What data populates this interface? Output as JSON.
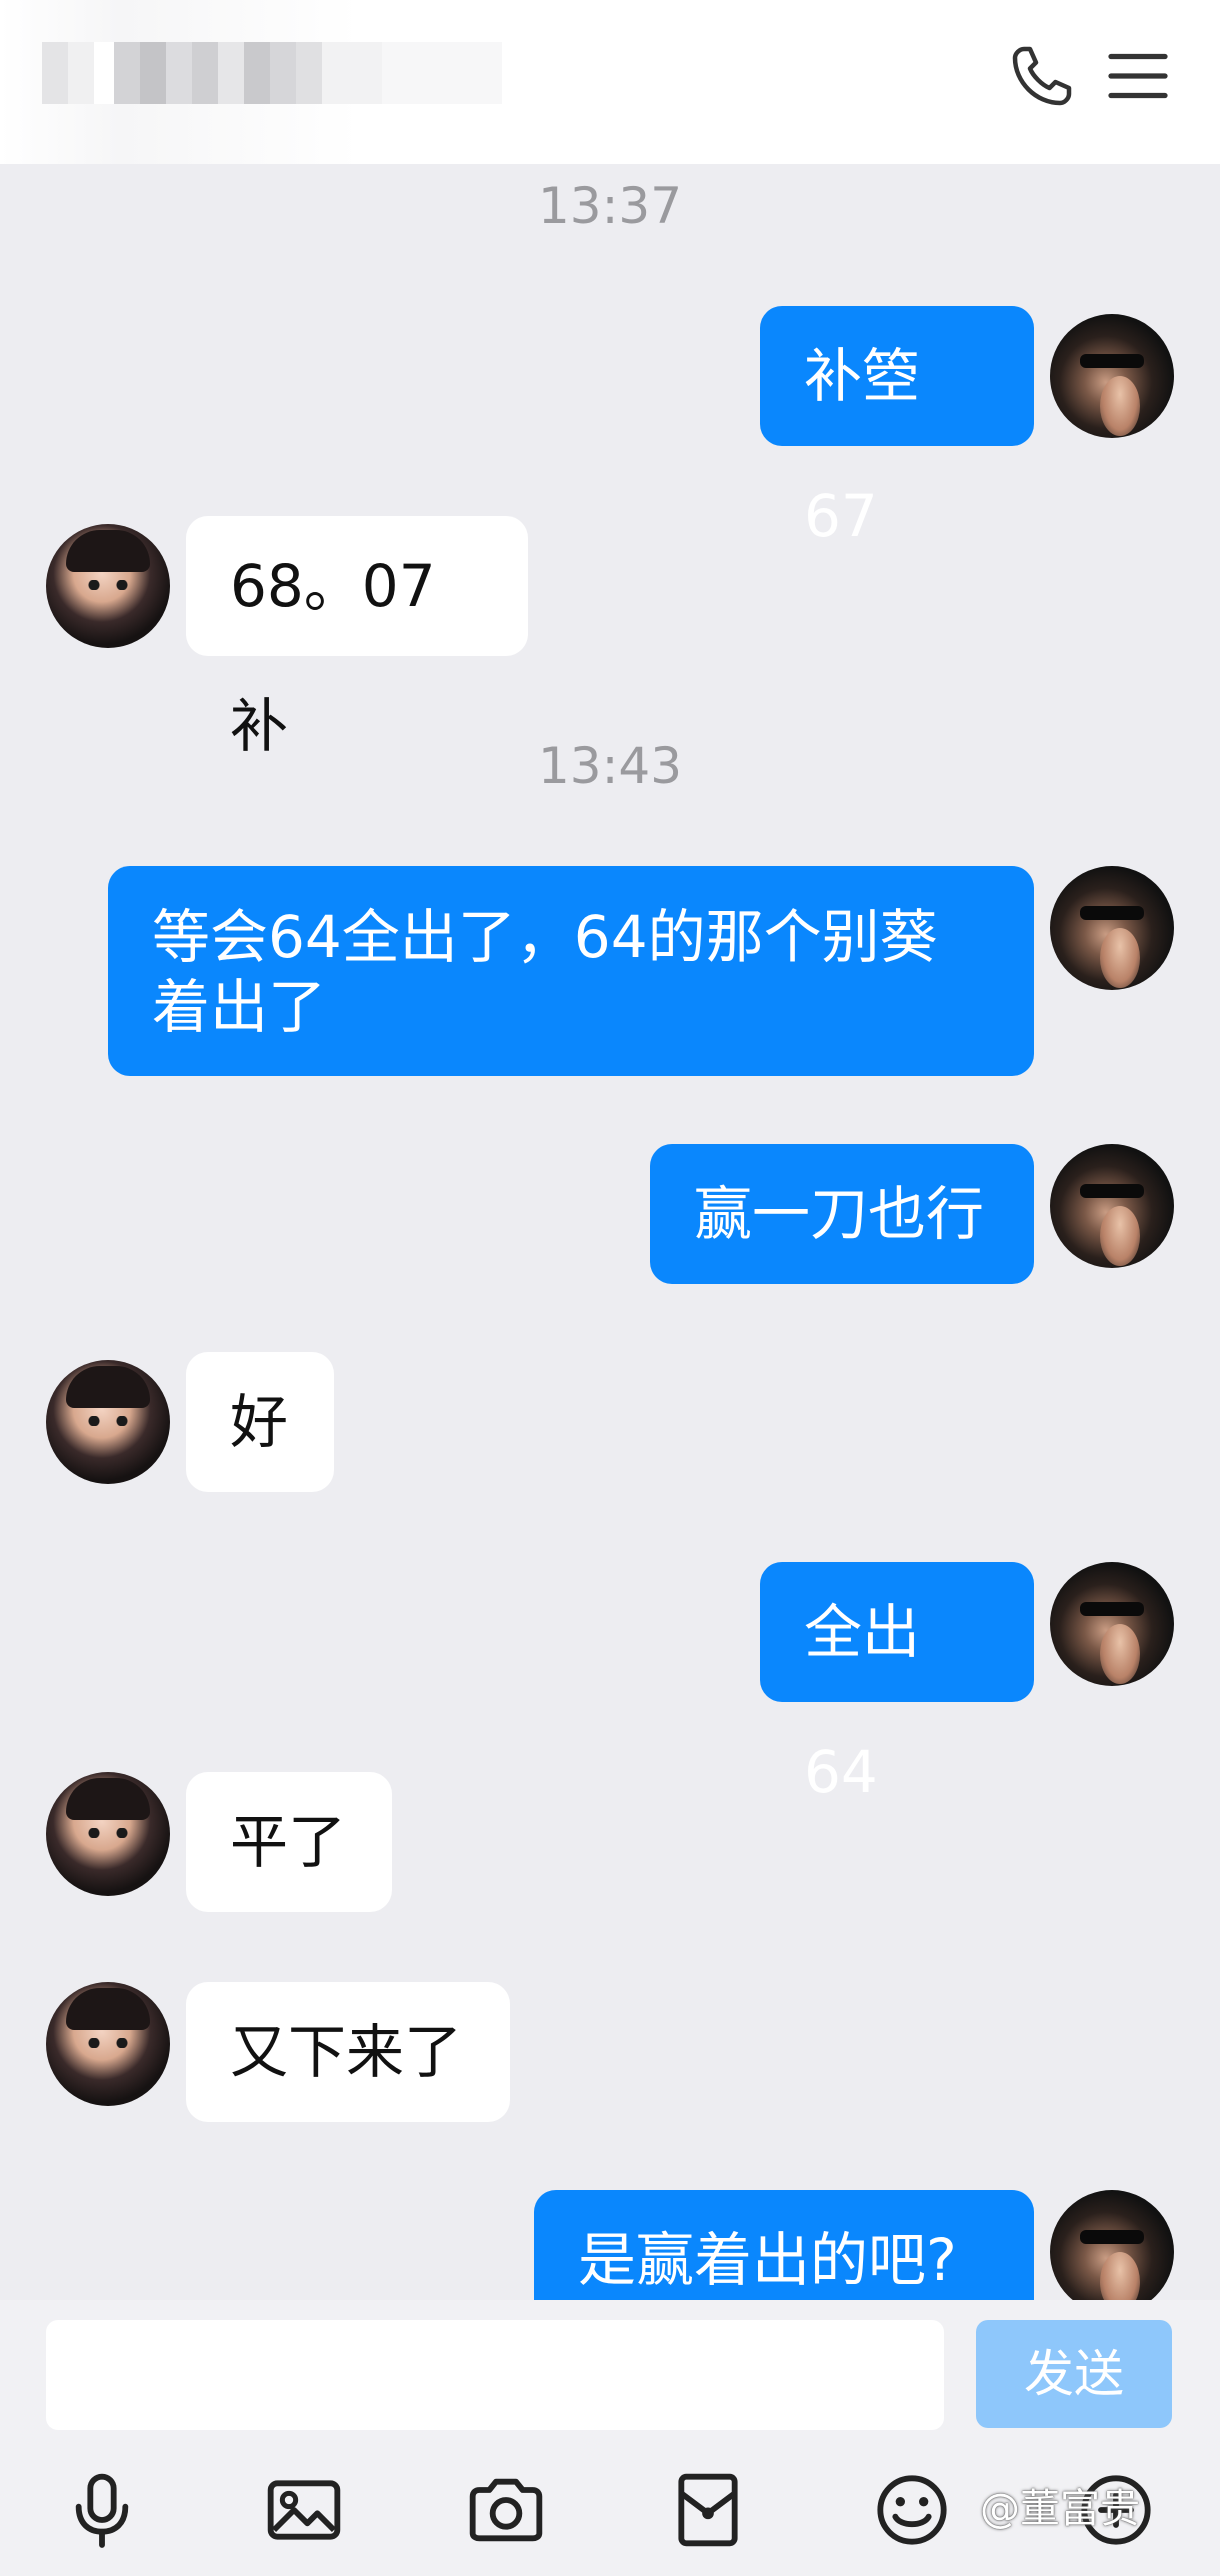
{
  "header": {
    "contact_name_blurred": true,
    "phone_icon": "phone-icon",
    "menu_icon": "menu-icon"
  },
  "messages": [
    {
      "type": "time",
      "text": "13:37"
    },
    {
      "type": "msg",
      "side": "mine",
      "text": "补箜67"
    },
    {
      "type": "msg",
      "side": "theirs",
      "text": "68。07补"
    },
    {
      "type": "time",
      "text": "13:43"
    },
    {
      "type": "msg",
      "side": "mine",
      "text": "等会64全出了，64的那个别葵\n着出了"
    },
    {
      "type": "msg",
      "side": "mine",
      "text": "赢一刀也行"
    },
    {
      "type": "msg",
      "side": "theirs",
      "text": "好"
    },
    {
      "type": "msg",
      "side": "mine",
      "text": "全出64"
    },
    {
      "type": "msg",
      "side": "theirs",
      "text": "平了"
    },
    {
      "type": "msg",
      "side": "theirs",
      "text": "又下来了"
    },
    {
      "type": "msg",
      "side": "mine",
      "text": "是赢着出的吧?"
    }
  ],
  "input": {
    "value": "",
    "send_label": "发送"
  },
  "toolbar": {
    "icons": [
      "microphone-icon",
      "image-icon",
      "camera-icon",
      "red-packet-icon",
      "emoji-icon",
      "more-icon"
    ]
  },
  "watermark": "@董富贵",
  "colors": {
    "mine_bubble": "#0a87fd",
    "theirs_bubble": "#ffffff",
    "background": "#ededf1",
    "send_button": "#8ec7fb"
  }
}
